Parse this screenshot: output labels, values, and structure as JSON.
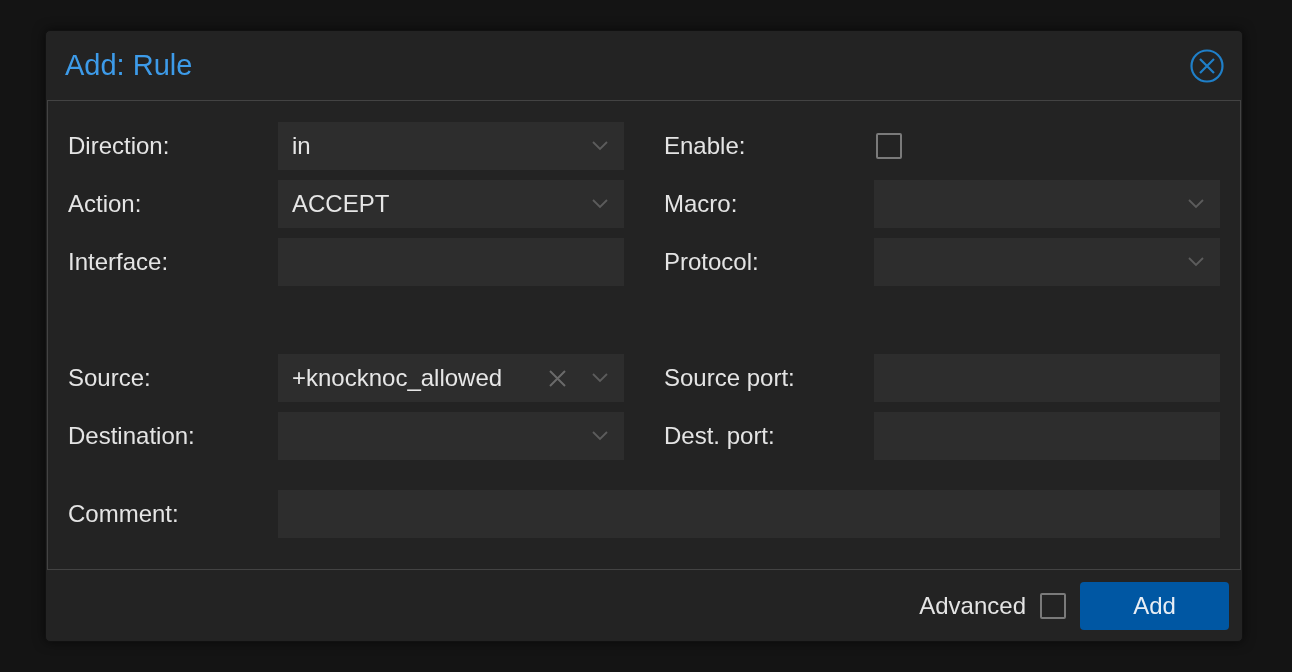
{
  "dialog": {
    "title": "Add: Rule",
    "sections": [
      {
        "rows": [
          {
            "left": {
              "label": "Direction:",
              "kind": "combo",
              "value": "in"
            },
            "right": {
              "label": "Enable:",
              "kind": "checkbox",
              "checked": false
            }
          },
          {
            "left": {
              "label": "Action:",
              "kind": "combo",
              "value": "ACCEPT"
            },
            "right": {
              "label": "Macro:",
              "kind": "combo"
            }
          },
          {
            "left": {
              "label": "Interface:",
              "kind": "text"
            },
            "right": {
              "label": "Protocol:",
              "kind": "combo"
            }
          }
        ]
      },
      {
        "rows": [
          {
            "left": {
              "label": "Source:",
              "kind": "combo",
              "value": "+knocknoc_allowed",
              "clearable": true
            },
            "right": {
              "label": "Source port:",
              "kind": "text"
            }
          },
          {
            "left": {
              "label": "Destination:",
              "kind": "combo"
            },
            "right": {
              "label": "Dest. port:",
              "kind": "text"
            }
          }
        ]
      },
      {
        "rows": [
          {
            "wide": {
              "label": "Comment:",
              "kind": "text"
            }
          }
        ]
      }
    ],
    "footer": {
      "advanced": {
        "label": "Advanced",
        "checked": false
      },
      "buttons": [
        "Add"
      ]
    }
  }
}
